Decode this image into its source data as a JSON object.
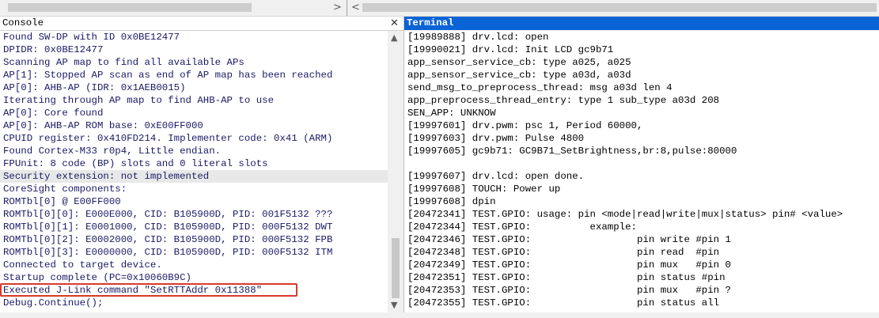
{
  "left_pane": {
    "title": "Console",
    "close_glyph": "✕",
    "lines": [
      {
        "text": "Found SW-DP with ID 0x0BE12477",
        "style": "dark"
      },
      {
        "text": "DPIDR: 0x0BE12477",
        "style": "dark"
      },
      {
        "text": "Scanning AP map to find all available APs",
        "style": "dark"
      },
      {
        "text": "AP[1]: Stopped AP scan as end of AP map has been reached",
        "style": "dark"
      },
      {
        "text": "AP[0]: AHB-AP (IDR: 0x1AEB0015)",
        "style": "dark"
      },
      {
        "text": "Iterating through AP map to find AHB-AP to use",
        "style": "dark"
      },
      {
        "text": "AP[0]: Core found",
        "style": "dark"
      },
      {
        "text": "AP[0]: AHB-AP ROM base: 0xE00FF000",
        "style": "dark"
      },
      {
        "text": "CPUID register: 0x410FD214. Implementer code: 0x41 (ARM)",
        "style": "dark"
      },
      {
        "text": "Found Cortex-M33 r0p4, Little endian.",
        "style": "dark"
      },
      {
        "text": "FPUnit: 8 code (BP) slots and 0 literal slots",
        "style": "dark"
      },
      {
        "text": "Security extension: not implemented",
        "style": "dark-hl"
      },
      {
        "text": "CoreSight components:",
        "style": "dark"
      },
      {
        "text": "ROMTbl[0] @ E00FF000",
        "style": "dark"
      },
      {
        "text": "ROMTbl[0][0]: E000E000, CID: B105900D, PID: 001F5132 ???",
        "style": "dark"
      },
      {
        "text": "ROMTbl[0][1]: E0001000, CID: B105900D, PID: 000F5132 DWT",
        "style": "dark"
      },
      {
        "text": "ROMTbl[0][2]: E0002000, CID: B105900D, PID: 000F5132 FPB",
        "style": "dark"
      },
      {
        "text": "ROMTbl[0][3]: E0000000, CID: B105900D, PID: 000F5132 ITM",
        "style": "dark"
      },
      {
        "text": "Connected to target device.",
        "style": "dark"
      },
      {
        "text": "Startup complete (PC=0x10060B9C)",
        "style": "dark"
      },
      {
        "text": "Executed J-Link command \"SetRTTAddr 0x11388\"",
        "style": "dark"
      },
      {
        "text": "Debug.Continue();",
        "style": "dark"
      }
    ]
  },
  "right_pane": {
    "title": "Terminal",
    "lines": [
      "[19989888] drv.lcd: open",
      "[19990021] drv.lcd: Init LCD gc9b71",
      "app_sensor_service_cb: type a025, a025",
      "app_sensor_service_cb: type a03d, a03d",
      "send_msg_to_preprocess_thread: msg a03d len 4",
      "app_preprocess_thread_entry: type 1 sub_type a03d 208",
      "SEN_APP: UNKNOW",
      "[19997601] drv.pwm: psc 1, Period 60000,",
      "[19997603] drv.pwm: Pulse 4800",
      "[19997605] gc9b71: GC9B71_SetBrightness,br:8,pulse:80000",
      "",
      "[19997607] drv.lcd: open done.",
      "[19997608] TOUCH: Power up",
      "[19997608] dpin",
      "[20472341] TEST.GPIO: usage: pin <mode|read|write|mux|status> pin# <value>",
      "[20472344] TEST.GPIO:          example:",
      "[20472346] TEST.GPIO:                  pin write #pin 1",
      "[20472348] TEST.GPIO:                  pin read  #pin",
      "[20472349] TEST.GPIO:                  pin mux   #pin 0",
      "[20472351] TEST.GPIO:                  pin status #pin",
      "[20472353] TEST.GPIO:                  pin mux   #pin ?",
      "[20472355] TEST.GPIO:                  pin status all"
    ]
  },
  "toolbar": {
    "arrow_left": "<",
    "arrow_right": ">",
    "arrow_left2": "<"
  },
  "colors": {
    "terminal_header": "#0a64d6",
    "highlight_box": "#d83a2b",
    "console_text": "#1a1a66"
  }
}
